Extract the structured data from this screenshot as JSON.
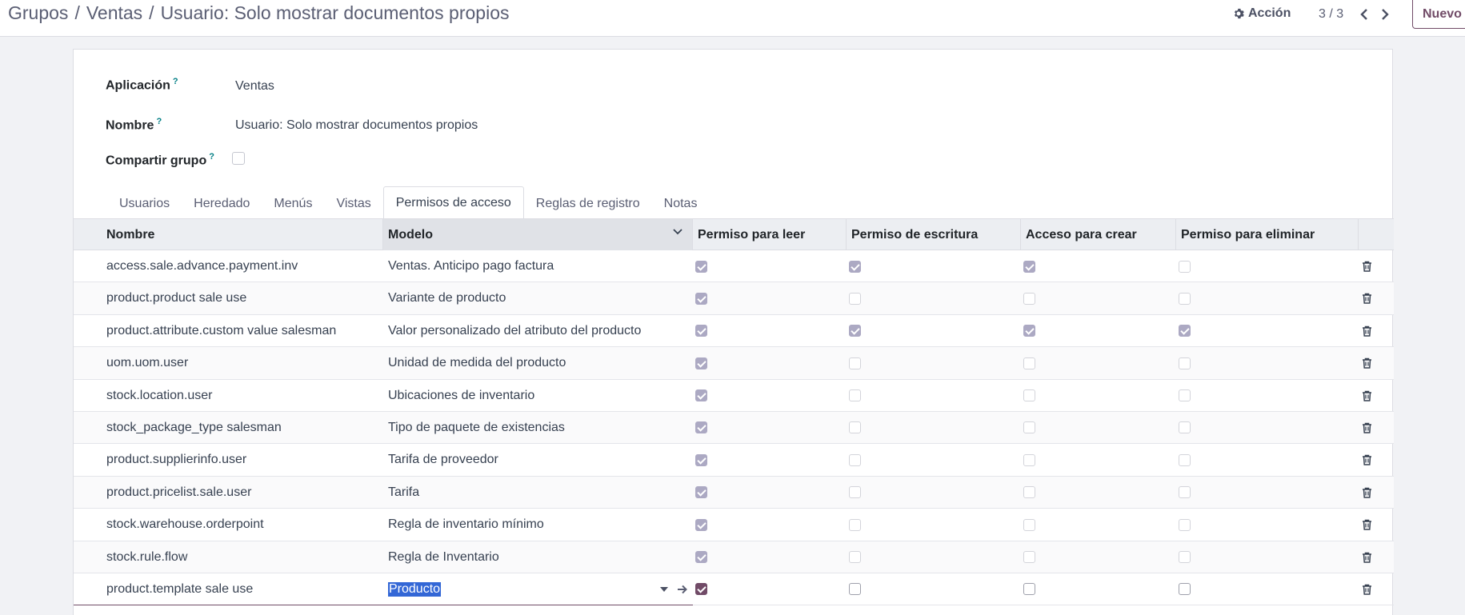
{
  "breadcrumb": {
    "items": [
      "Grupos",
      "Ventas"
    ],
    "current": "Usuario: Solo mostrar documentos propios",
    "separator": "/"
  },
  "toolbar": {
    "action_label": "Acción",
    "pager_value": "3 / 3",
    "new_label": "Nuevo"
  },
  "form": {
    "fields": [
      {
        "label": "Aplicación",
        "help": "?",
        "value": "Ventas"
      },
      {
        "label": "Nombre",
        "help": "?",
        "value": "Usuario: Solo mostrar documentos propios"
      },
      {
        "label": "Compartir grupo",
        "help": "?",
        "checked": false
      }
    ]
  },
  "tabs": [
    {
      "label": "Usuarios",
      "active": false
    },
    {
      "label": "Heredado",
      "active": false
    },
    {
      "label": "Menús",
      "active": false
    },
    {
      "label": "Vistas",
      "active": false
    },
    {
      "label": "Permisos de acceso",
      "active": true
    },
    {
      "label": "Reglas de registro",
      "active": false
    },
    {
      "label": "Notas",
      "active": false
    }
  ],
  "table": {
    "columns": [
      "Nombre",
      "Modelo",
      "Permiso para leer",
      "Permiso de escritura",
      "Acceso para crear",
      "Permiso para eliminar"
    ],
    "rows": [
      {
        "name": "access.sale.advance.payment.inv",
        "model": "Ventas. Anticipo pago factura",
        "read": true,
        "write": true,
        "create": true,
        "unlink": false
      },
      {
        "name": "product.product sale use",
        "model": "Variante de producto",
        "read": true,
        "write": false,
        "create": false,
        "unlink": false
      },
      {
        "name": "product.attribute.custom value salesman",
        "model": "Valor personalizado del atributo del producto",
        "read": true,
        "write": true,
        "create": true,
        "unlink": true
      },
      {
        "name": "uom.uom.user",
        "model": "Unidad de medida del producto",
        "read": true,
        "write": false,
        "create": false,
        "unlink": false
      },
      {
        "name": "stock.location.user",
        "model": "Ubicaciones de inventario",
        "read": true,
        "write": false,
        "create": false,
        "unlink": false
      },
      {
        "name": "stock_package_type salesman",
        "model": "Tipo de paquete de existencias",
        "read": true,
        "write": false,
        "create": false,
        "unlink": false
      },
      {
        "name": "product.supplierinfo.user",
        "model": "Tarifa de proveedor",
        "read": true,
        "write": false,
        "create": false,
        "unlink": false
      },
      {
        "name": "product.pricelist.sale.user",
        "model": "Tarifa",
        "read": true,
        "write": false,
        "create": false,
        "unlink": false
      },
      {
        "name": "stock.warehouse.orderpoint",
        "model": "Regla de inventario mínimo",
        "read": true,
        "write": false,
        "create": false,
        "unlink": false
      },
      {
        "name": "stock.rule.flow",
        "model": "Regla de Inventario",
        "read": true,
        "write": false,
        "create": false,
        "unlink": false
      },
      {
        "name": "product.template sale use",
        "model": "Producto",
        "read": true,
        "write": false,
        "create": false,
        "unlink": false,
        "editing": true
      }
    ]
  },
  "colors": {
    "brand": "#714b67",
    "checked_readonly": "#aca9c3",
    "header_bg": "#eceef2",
    "help_marker": "#017e84"
  },
  "icons": {
    "action": "gear-icon",
    "pager_prev": "chevron-left-icon",
    "pager_next": "chevron-right-icon",
    "sort": "chevron-down-icon",
    "delete": "trash-icon",
    "dropdown": "caret-down-icon",
    "open_record": "arrow-right-icon"
  }
}
